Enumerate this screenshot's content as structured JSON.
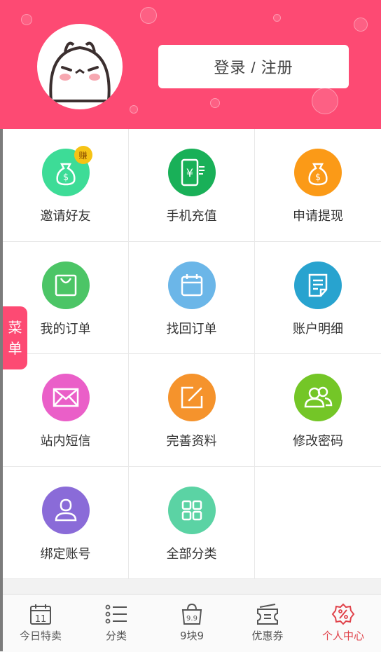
{
  "header": {
    "login_label": "登录 / 注册",
    "bg_color": "#fd4a73",
    "avatar_icon": "cartoon-avatar-icon"
  },
  "grid": {
    "items": [
      {
        "label": "邀请好友",
        "icon": "money-bag-icon",
        "color": "#3ddc97",
        "badge": "赚"
      },
      {
        "label": "手机充值",
        "icon": "phone-yen-icon",
        "color": "#19b058"
      },
      {
        "label": "申请提现",
        "icon": "money-bag-icon",
        "color": "#fb9a17"
      },
      {
        "label": "我的订单",
        "icon": "shopping-bag-icon",
        "color": "#4cc566"
      },
      {
        "label": "找回订单",
        "icon": "calendar-icon",
        "color": "#6bb6e8"
      },
      {
        "label": "账户明细",
        "icon": "document-icon",
        "color": "#28a3cf"
      },
      {
        "label": "站内短信",
        "icon": "envelope-icon",
        "color": "#ea5fc8"
      },
      {
        "label": "完善资料",
        "icon": "edit-icon",
        "color": "#f5932c"
      },
      {
        "label": "修改密码",
        "icon": "users-icon",
        "color": "#74c627"
      },
      {
        "label": "绑定账号",
        "icon": "person-icon",
        "color": "#8a6bd8"
      },
      {
        "label": "全部分类",
        "icon": "grid-icon",
        "color": "#5bd3a4"
      }
    ]
  },
  "side_tab": {
    "line1": "菜",
    "line2": "单"
  },
  "tabbar": {
    "items": [
      {
        "label": "今日特卖",
        "icon": "calendar-day-icon",
        "day": "11"
      },
      {
        "label": "分类",
        "icon": "list-icon"
      },
      {
        "label": "9块9",
        "icon": "shopping-bag-99-icon",
        "badge_text": "9.9"
      },
      {
        "label": "优惠券",
        "icon": "coupon-icon"
      },
      {
        "label": "个人中心",
        "icon": "percent-badge-icon",
        "active": true
      }
    ],
    "active_color": "#e0424a"
  }
}
